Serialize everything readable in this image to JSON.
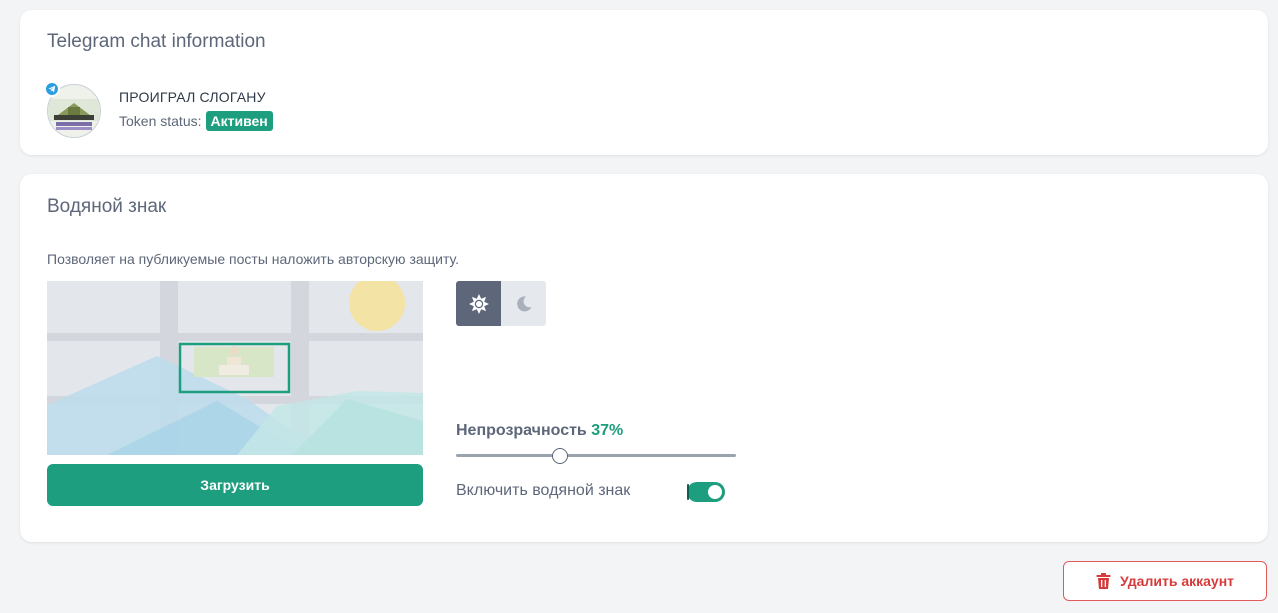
{
  "chat_info": {
    "title": "Telegram chat information",
    "chat_name": "ПРОИГРАЛ СЛОГАНУ",
    "token_label": "Token status:",
    "token_status": "Активен"
  },
  "watermark": {
    "title": "Водяной знак",
    "description": "Позволяет на публикуемые посты наложить авторскую защиту.",
    "upload_label": "Загрузить",
    "theme_options": [
      "sun-icon",
      "moon-icon"
    ],
    "selected_theme": "light",
    "opacity_label": "Непрозрачность",
    "opacity_value": "37%",
    "opacity_fraction": 0.37,
    "enable_label": "Включить водяной знак",
    "enabled": true
  },
  "account": {
    "delete_label": "Удалить аккаунт"
  },
  "colors": {
    "accent": "#1d9e7e",
    "danger": "#d63a3a",
    "telegram": "#2a9ee2"
  }
}
